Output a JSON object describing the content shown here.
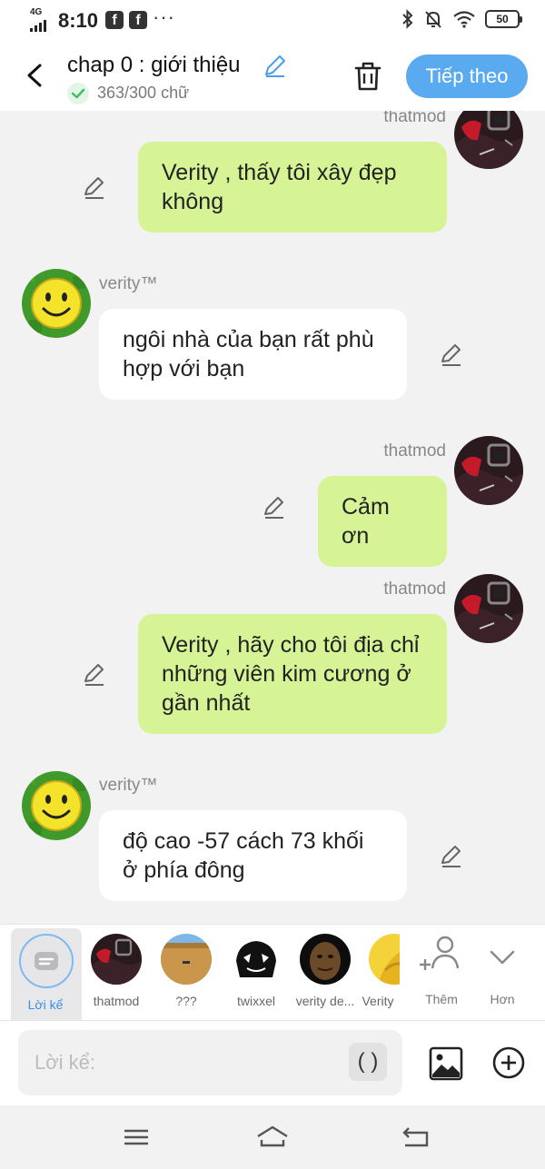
{
  "status_bar": {
    "network": "4G",
    "time": "8:10",
    "notif_1": "f",
    "notif_2": "f",
    "more": "···",
    "battery": "50"
  },
  "header": {
    "title": "chap 0 : giới thiệu",
    "word_count": "363/300 chữ",
    "next_button": "Tiếp theo"
  },
  "messages": [
    {
      "sender": "thatmod",
      "side": "right",
      "text": "Verity , thấy tôi xây đẹp không"
    },
    {
      "sender": "verity™",
      "side": "left",
      "text": "ngôi nhà của bạn rất phù hợp với bạn"
    },
    {
      "sender": "thatmod",
      "side": "right",
      "text": "Cảm ơn"
    },
    {
      "sender": "thatmod",
      "side": "right",
      "text": "Verity , hãy cho tôi địa chỉ những viên kim cương ở gần nhất"
    },
    {
      "sender": "verity™",
      "side": "left",
      "text": "độ cao -57 cách 73 khối ở phía đông"
    }
  ],
  "characters": [
    {
      "label": "Lời kể",
      "icon": "narrator-icon",
      "selected": true
    },
    {
      "label": "thatmod",
      "icon": "avatar-robot"
    },
    {
      "label": "???",
      "icon": "avatar-box"
    },
    {
      "label": "twixxel",
      "icon": "avatar-sketch"
    },
    {
      "label": "verity de...",
      "icon": "avatar-dark"
    },
    {
      "label": "Verity",
      "icon": "avatar-yellow"
    }
  ],
  "tools": {
    "add_label": "Thêm",
    "more_label": "Hơn"
  },
  "input": {
    "placeholder": "Lời kể:",
    "paren_button": "( )"
  },
  "colors": {
    "accent": "#5aaaf0",
    "my_bubble": "#d6f495",
    "their_bubble": "#ffffff",
    "background": "#f2f2f2"
  }
}
